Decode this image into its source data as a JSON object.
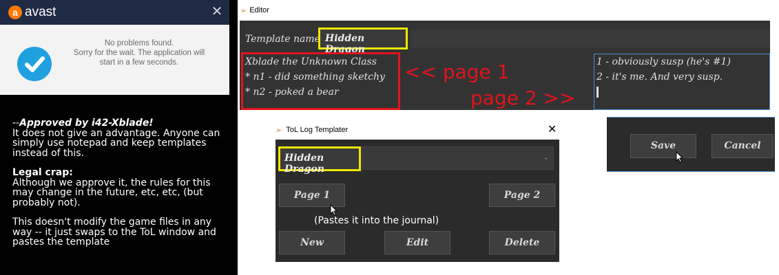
{
  "avast": {
    "brand": "avast",
    "message_lines": [
      "No problems found.",
      "Sorry for the wait. The application will",
      "start in a few seconds."
    ],
    "close_icon": "close-icon",
    "status_icon": "check-circle-icon",
    "colors": {
      "header": "#1f2a44",
      "brand_orange": "#ff7800",
      "check_blue": "#1fa1e0"
    }
  },
  "notes": {
    "approved_prefix": "--",
    "approved": "Approved by i42-Xblade!",
    "approved_text": "It does not give an advantage. Anyone can simply use notepad and keep templates instead of this.",
    "legal_title": "Legal crap:",
    "legal_text": "Although we approve it, the rules for this may change in the future, etc, etc, (but probably not).",
    "modify_text": "This doesn't modify the game files in any way -- it just swaps to the ToL window and pastes the template"
  },
  "editor": {
    "title": "Editor",
    "template_label": "Template name:",
    "template_name": "Hidden Dragon",
    "page1_lines": [
      "Xblade the Unknown Class",
      "* n1 - did something sketchy",
      "* n2 - poked a bear"
    ],
    "page2_lines": [
      "1 - obviously susp (he's #1)",
      "2 - it's me. And very susp."
    ],
    "annotation_page1": "<< page 1",
    "annotation_page2": "page 2 >>",
    "save_label": "Save",
    "cancel_label": "Cancel",
    "colors": {
      "highlight_yellow": "#f0e800",
      "highlight_red": "#e0141e",
      "focus_blue": "#4a90d9"
    }
  },
  "templater": {
    "title": "ToL Log Templater",
    "selected_template": "Hidden Dragon",
    "page1_label": "Page 1",
    "page2_label": "Page 2",
    "paste_note": "(Pastes it into the journal)",
    "new_label": "New",
    "edit_label": "Edit",
    "delete_label": "Delete"
  }
}
